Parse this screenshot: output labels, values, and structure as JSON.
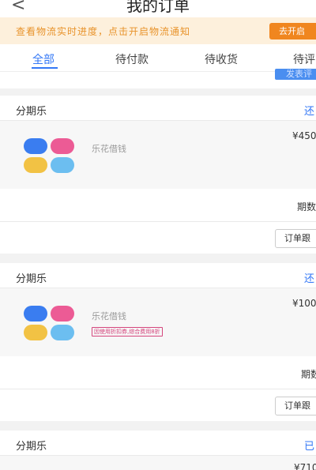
{
  "header": {
    "title": "我的订单",
    "back_icon": "chevron-left-icon"
  },
  "notice": {
    "text": "查看物流实时进度，点击开启物流通知",
    "button": "去开启"
  },
  "tabs": [
    {
      "label": "全部",
      "active": true
    },
    {
      "label": "待付款",
      "active": false
    },
    {
      "label": "待收货",
      "active": false
    },
    {
      "label": "待评",
      "active": false
    }
  ],
  "partial_card": {
    "button": "发表评"
  },
  "orders": [
    {
      "shop": "分期乐",
      "status": "还",
      "item_name": "乐花借钱",
      "price": "¥450",
      "promo": "",
      "periods": "期数",
      "track_button": "订单跟"
    },
    {
      "shop": "分期乐",
      "status": "还",
      "item_name": "乐花借钱",
      "price": "¥100",
      "promo": "因使用折扣券,综合费用8折",
      "periods": "期数",
      "track_button": "订单跟"
    },
    {
      "shop": "分期乐",
      "status": "已",
      "price": "¥710"
    }
  ],
  "colors": {
    "accent": "#3478f6",
    "notice_bg": "#fdf0dc",
    "notice_text": "#e8932b",
    "notice_button": "#f0861f"
  }
}
